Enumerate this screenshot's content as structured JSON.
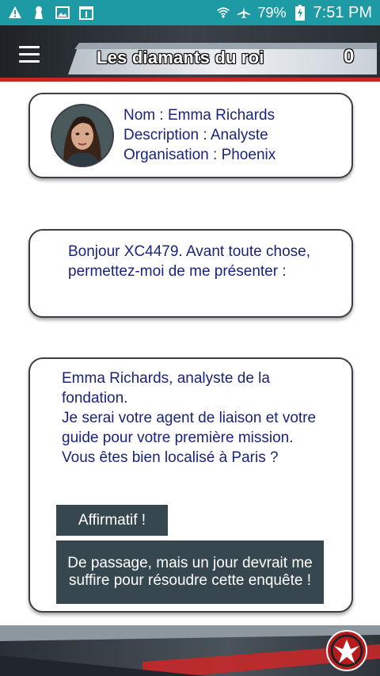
{
  "status_bar": {
    "battery_percent": "79%",
    "time": "7:51 PM",
    "icons": [
      "warning-icon",
      "notification-icon",
      "image-icon",
      "calendar-icon",
      "wifi-icon",
      "airplane-icon",
      "battery-charging-icon"
    ]
  },
  "header": {
    "title": "Les diamants du roi",
    "score": "0",
    "menu_icon": "hamburger-menu-icon"
  },
  "profile": {
    "name_line": "Nom : Emma Richards",
    "description_line": "Description : Analyste",
    "organisation_line": "Organisation : Phoenix"
  },
  "messages": [
    {
      "text": "Bonjour XC4479. Avant toute chose, permettez-moi de me présenter :"
    },
    {
      "lines": [
        "Emma Richards, analyste de la fondation.",
        "Je serai votre agent de liaison et votre guide pour votre première mission. Vous êtes bien localisé à Paris ?"
      ]
    }
  ],
  "choices": {
    "affirm": "Affirmatif !",
    "passing_through": "De passage, mais un jour devrait me suffire pour résoudre cette enquête !"
  },
  "colors": {
    "status_bar": "#1e9aa5",
    "header_dark": "#2b3136",
    "accent_red": "#c62828",
    "text_blue": "#1a237e",
    "button_bg": "#37474f"
  }
}
